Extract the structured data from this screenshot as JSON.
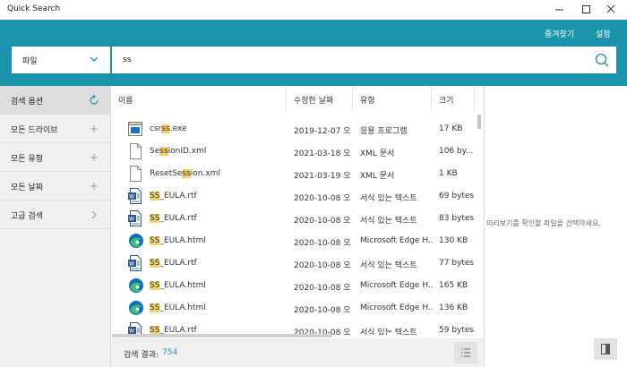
{
  "window": {
    "title": "Quick Search"
  },
  "topbar": {
    "favorites_label": "즐겨찾기",
    "settings_label": "설정"
  },
  "search": {
    "scope_value": "파일",
    "query": "ss"
  },
  "sidebar": {
    "items": [
      {
        "label": "검색 옵션",
        "icon": "refresh-icon"
      },
      {
        "label": "모든 드라이브",
        "icon": "plus-icon"
      },
      {
        "label": "모든 유형",
        "icon": "plus-icon"
      },
      {
        "label": "모든 날짜",
        "icon": "plus-icon"
      },
      {
        "label": "고급 검색",
        "icon": "chevron-right-icon"
      }
    ]
  },
  "table": {
    "columns": [
      "이름",
      "수정한 날짜",
      "유형",
      "크기"
    ],
    "rows": [
      {
        "name": "csrss.exe",
        "date": "2019-12-07 오...",
        "type": "응용 프로그램",
        "size": "17 KB",
        "icon": "exe-icon"
      },
      {
        "name": "SessionID.xml",
        "date": "2021-03-18 오...",
        "type": "XML 문서",
        "size": "106 by...",
        "icon": "xml-file-icon"
      },
      {
        "name": "ResetSession.xml",
        "date": "2021-03-19 오...",
        "type": "XML 문서",
        "size": "1 KB",
        "icon": "xml-file-icon"
      },
      {
        "name": "SS_EULA.rtf",
        "date": "2020-10-08 오...",
        "type": "서식 있는 텍스트",
        "size": "69 bytes",
        "icon": "word-doc-icon"
      },
      {
        "name": "SS_EULA.rtf",
        "date": "2020-10-08 오...",
        "type": "서식 있는 텍스트",
        "size": "83 bytes",
        "icon": "word-doc-icon"
      },
      {
        "name": "SS_EULA.html",
        "date": "2020-10-08 오...",
        "type": "Microsoft Edge H...",
        "size": "130 KB",
        "icon": "edge-icon"
      },
      {
        "name": "SS_EULA.rtf",
        "date": "2020-10-08 오...",
        "type": "서식 있는 텍스트",
        "size": "77 bytes",
        "icon": "word-doc-icon"
      },
      {
        "name": "SS_EULA.html",
        "date": "2020-10-08 오...",
        "type": "Microsoft Edge H...",
        "size": "165 KB",
        "icon": "edge-icon"
      },
      {
        "name": "SS_EULA.html",
        "date": "2020-10-08 오...",
        "type": "Microsoft Edge H...",
        "size": "136 KB",
        "icon": "edge-icon"
      },
      {
        "name": "SS_EULA.rtf",
        "date": "2020-10-08 오...",
        "type": "서식 있는 텍스트",
        "size": "59 bytes",
        "icon": "word-doc-icon"
      }
    ]
  },
  "status": {
    "label": "검색 결과:",
    "count": "754"
  },
  "preview": {
    "message": "미리보기를 확인할 파일을 선택하세요."
  },
  "colors": {
    "accent": "#1b93ab",
    "sidebar_bg": "#f0f0f0",
    "highlight": "#f5d36a"
  }
}
